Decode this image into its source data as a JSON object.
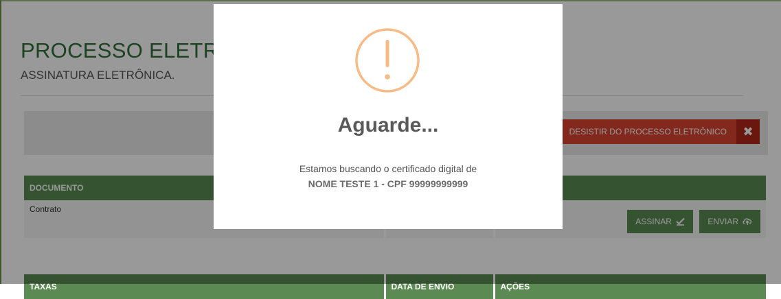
{
  "header": {
    "title": "PROCESSO ELETRÔNICO",
    "subtitle": "ASSINATURA ELETRÔNICA."
  },
  "toolbar": {
    "desist_label": "DESISTIR DO PROCESSO ELETRÔNICO",
    "close_symbol": "✖"
  },
  "documents_table": {
    "columns": [
      "DOCUMENTO",
      "",
      ""
    ],
    "rows": [
      {
        "document": "Contrato"
      }
    ],
    "sign_label": "ASSINAR",
    "send_label": "ENVIAR"
  },
  "fees_table": {
    "columns": [
      "TAXAS",
      "DATA DE ENVIO",
      "AÇÕES"
    ]
  },
  "modal": {
    "title": "Aguarde...",
    "message": "Estamos buscando o certificado digital de",
    "certificate_holder": "NOME TESTE 1 - CPF 99999999999",
    "icon": "warning-icon",
    "icon_color": "#f8bb86"
  },
  "colors": {
    "brand_green": "#5b8a52",
    "title_green": "#2f6f3a",
    "danger_red": "#d9442f",
    "danger_dark": "#b1281a"
  }
}
